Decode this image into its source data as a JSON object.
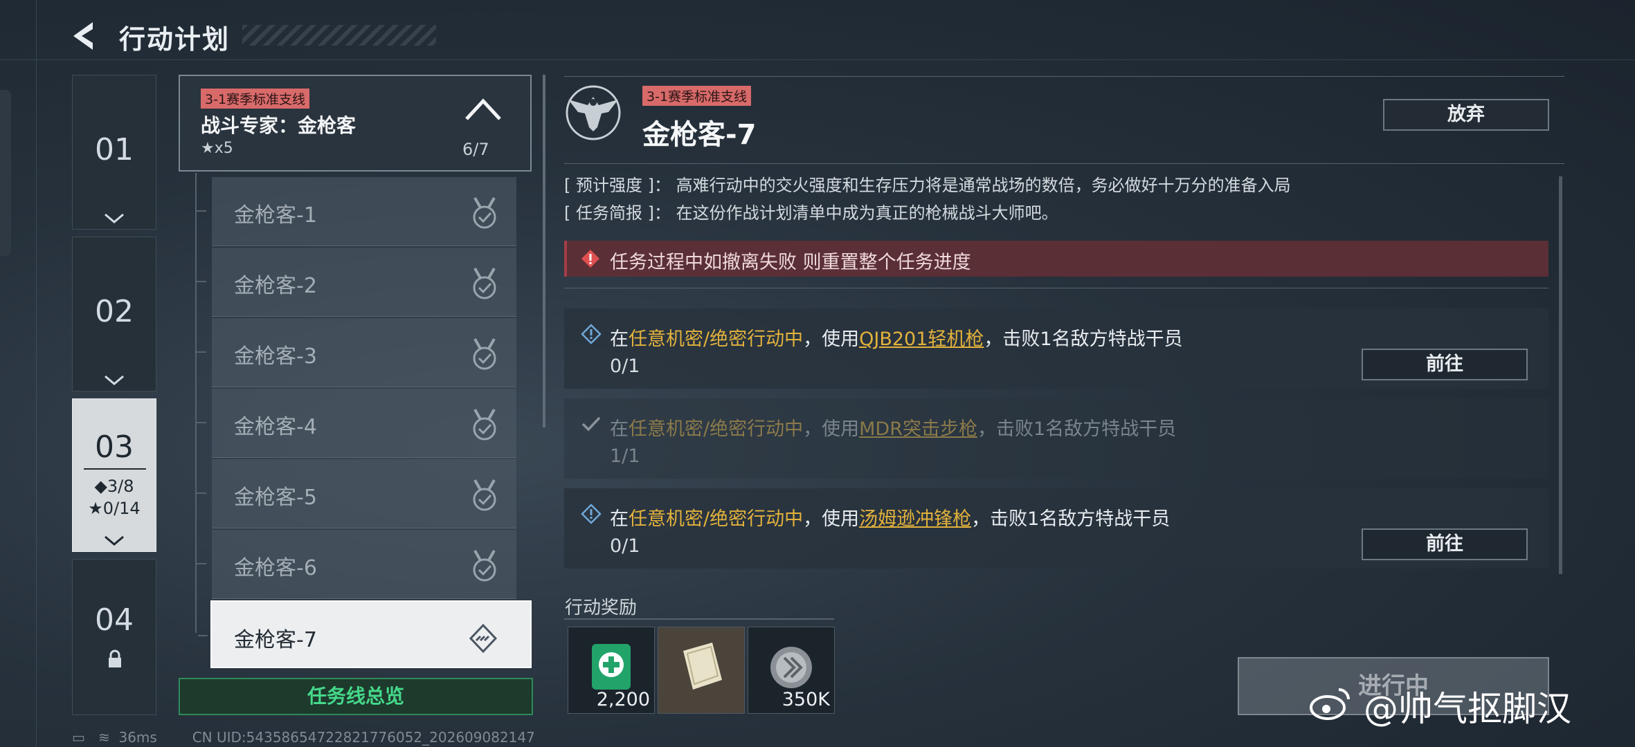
{
  "header": {
    "title": "行动计划"
  },
  "chapters": [
    {
      "number": "01"
    },
    {
      "number": "02"
    },
    {
      "number": "03",
      "diamonds": "◆3/8",
      "stars": "★0/14"
    },
    {
      "number": "04"
    }
  ],
  "questline": {
    "tag": "3-1赛季标准支线",
    "name": "战斗专家：金枪客",
    "stars": "★x5",
    "progress": "6/7",
    "steps": [
      "金枪客-1",
      "金枪客-2",
      "金枪客-3",
      "金枪客-4",
      "金枪客-5",
      "金枪客-6",
      "金枪客-7"
    ],
    "overview_label": "任务线总览"
  },
  "mission": {
    "tag": "3-1赛季标准支线",
    "title": "金枪客-7",
    "abandon_label": "放弃",
    "intensity_label": "[ 预计强度 ]",
    "intensity_text": "高难行动中的交火强度和生存压力将是通常战场的数倍，务必做好十万分的准备入局",
    "brief_label": "[ 任务简报 ]",
    "brief_text": "在这份作战计划清单中成为真正的枪械战斗大师吧。",
    "warning": "任务过程中如撤离失败 则重置整个任务进度",
    "tasks": [
      {
        "pre": "在",
        "mode": "任意机密/绝密行动中",
        "mid": "，使用",
        "weapon": "QJB201轻机枪",
        "post": "，击败1名敌方特战干员",
        "count": "0/1",
        "button": "前往"
      },
      {
        "pre": "在",
        "mode": "任意机密/绝密行动中",
        "mid": "，使用",
        "weapon": "MDR突击步枪",
        "post": "，击败1名敌方特战干员",
        "count": "1/1"
      },
      {
        "pre": "在",
        "mode": "任意机密/绝密行动中",
        "mid": "，使用",
        "weapon": "汤姆逊冲锋枪",
        "post": "，击败1名敌方特战干员",
        "count": "0/1",
        "button": "前往"
      }
    ],
    "rewards_label": "行动奖励",
    "rewards": [
      {
        "icon": "medkit-icon",
        "qty": "2,200"
      },
      {
        "icon": "document-icon",
        "qty": ""
      },
      {
        "icon": "coin-icon",
        "qty": "350K"
      }
    ],
    "status_button": "进行中"
  },
  "watermark": "@帅气抠脚汉",
  "status_bar": {
    "ping": "36ms",
    "uid": "CN UID:54358654722821776052_202609082147"
  },
  "colors": {
    "accent_gold": "#e3b23c",
    "tag_red": "#d86a6a",
    "overview_green": "#45d88a",
    "warning_bg": "#5a2f36"
  }
}
